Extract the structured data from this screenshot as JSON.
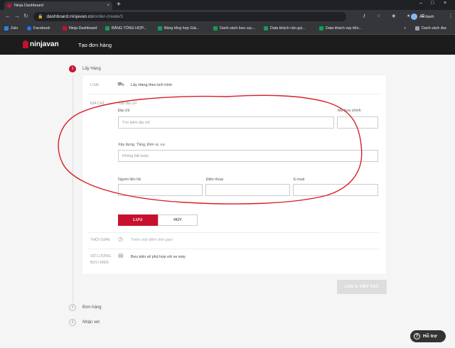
{
  "browser": {
    "tab_title": "Ninja Dashboard",
    "tab_close": "×",
    "new_tab": "+",
    "window_controls": [
      "–",
      "□",
      "×"
    ],
    "nav": {
      "back": "←",
      "forward": "→",
      "reload": "↻"
    },
    "url_host": "dashboard.ninjavan.co",
    "url_path": "/order-create/1",
    "lock": "🔒",
    "toolbar_icons": "⚷ ☆ ◉ ★ ⧉",
    "profile_label": "Ẩn danh",
    "menu": "⋮",
    "bookmarks": [
      {
        "label": "Zalo",
        "color": "#2f80ed"
      },
      {
        "label": "Facebook",
        "color": "#1877f2"
      },
      {
        "label": "Ninja Dashboard",
        "color": "#c8102e"
      },
      {
        "label": "BẢNG TỔNG HỢP...",
        "color": "#0f9d58"
      },
      {
        "label": "Bảng tổng hợp Giá...",
        "color": "#0f9d58"
      },
      {
        "label": "Danh sách bưu cục...",
        "color": "#0f9d58"
      },
      {
        "label": "Data khách cần gọi...",
        "color": "#0f9d58"
      },
      {
        "label": "Data khách vay tiền...",
        "color": "#0f9d58"
      }
    ],
    "bookmarks_more": "»",
    "reading_list": "Danh sách đọc"
  },
  "app": {
    "logo": "ninjavan",
    "page_title": "Tạo đơn hàng",
    "brand_color": "#c8102e"
  },
  "steps": [
    {
      "num": "1",
      "label": "Lấy Hàng"
    },
    {
      "num": "2",
      "label": "Đơn hàng"
    },
    {
      "num": "3",
      "label": "Nhận xét"
    }
  ],
  "form": {
    "type_label": "LOẠI",
    "type_value": "Lấy Hàng theo lịch trình",
    "address_label": "ĐỊA CHỈ",
    "create_address": "Tạo địa chỉ",
    "address_field_label": "Địa chỉ",
    "address_placeholder": "Tìm kiếm địa chỉ",
    "postal_label": "Mã bưu chính",
    "building_label": "Xây dựng, Tầng, Đơn vị, v.v.",
    "building_placeholder": "Không bắt buộc",
    "contact_label": "Người liên hệ",
    "phone_label": "Điện thoại",
    "email_label": "E-mail",
    "save_label": "LƯU",
    "cancel_label": "HỦY",
    "time_label": "THỜI GIAN",
    "time_placeholder": "Thêm một điểm thời gian",
    "parcel_label_1": "SỐ LƯỢNG",
    "parcel_label_2": "BƯU KIỆN",
    "parcel_value": "Bưu kiện sẽ phù hợp với xe máy",
    "next_label": "LƯU & TIẾP TỤC"
  },
  "help": {
    "icon": "?",
    "label": "Hỗ trợ"
  }
}
